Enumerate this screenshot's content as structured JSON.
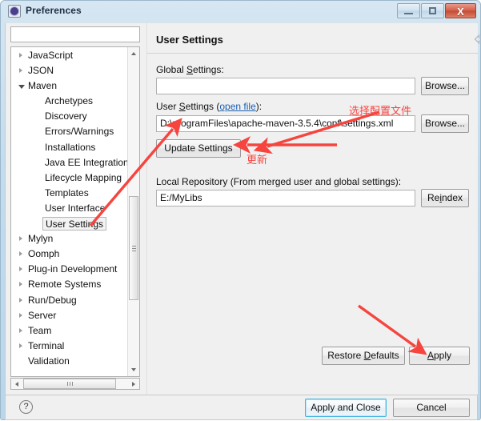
{
  "window": {
    "title": "Preferences",
    "icon": "preferences-gear-icon",
    "controls": {
      "minimize": "–",
      "maximize": "□",
      "close": "X"
    }
  },
  "sidebar": {
    "filter_value": "",
    "filter_placeholder": "",
    "items": [
      {
        "label": "JavaScript",
        "level": 1,
        "state": "collapsed",
        "selected": false
      },
      {
        "label": "JSON",
        "level": 1,
        "state": "collapsed",
        "selected": false
      },
      {
        "label": "Maven",
        "level": 1,
        "state": "expanded",
        "selected": false
      },
      {
        "label": "Archetypes",
        "level": 2,
        "state": "leaf",
        "selected": false
      },
      {
        "label": "Discovery",
        "level": 2,
        "state": "leaf",
        "selected": false
      },
      {
        "label": "Errors/Warnings",
        "level": 2,
        "state": "leaf",
        "selected": false
      },
      {
        "label": "Installations",
        "level": 2,
        "state": "leaf",
        "selected": false
      },
      {
        "label": "Java EE Integration",
        "level": 2,
        "state": "leaf",
        "selected": false
      },
      {
        "label": "Lifecycle Mapping",
        "level": 2,
        "state": "leaf",
        "selected": false
      },
      {
        "label": "Templates",
        "level": 2,
        "state": "leaf",
        "selected": false
      },
      {
        "label": "User Interface",
        "level": 2,
        "state": "leaf",
        "selected": false
      },
      {
        "label": "User Settings",
        "level": 2,
        "state": "leaf",
        "selected": true
      },
      {
        "label": "Mylyn",
        "level": 1,
        "state": "collapsed",
        "selected": false
      },
      {
        "label": "Oomph",
        "level": 1,
        "state": "collapsed",
        "selected": false
      },
      {
        "label": "Plug-in Development",
        "level": 1,
        "state": "collapsed",
        "selected": false
      },
      {
        "label": "Remote Systems",
        "level": 1,
        "state": "collapsed",
        "selected": false
      },
      {
        "label": "Run/Debug",
        "level": 1,
        "state": "collapsed",
        "selected": false
      },
      {
        "label": "Server",
        "level": 1,
        "state": "collapsed",
        "selected": false
      },
      {
        "label": "Team",
        "level": 1,
        "state": "collapsed",
        "selected": false
      },
      {
        "label": "Terminal",
        "level": 1,
        "state": "collapsed",
        "selected": false
      },
      {
        "label": "Validation",
        "level": 1,
        "state": "leaf",
        "selected": false
      }
    ]
  },
  "page": {
    "title": "User Settings",
    "nav": {
      "back": "back-arrow-icon",
      "back_menu": "chevron-down-icon",
      "forward": "forward-arrow-icon",
      "forward_menu": "chevron-down-icon",
      "overflow": "chevron-down-filled-icon"
    },
    "global_settings": {
      "label_pre": "Global ",
      "label_underlined": "S",
      "label_post": "ettings:",
      "value": "",
      "browse_label": "Browse..."
    },
    "user_settings": {
      "label_pre": "User ",
      "label_underlined": "S",
      "label_mid": "ettings (",
      "link_label": "open file",
      "label_post": "):",
      "value": "D:\\programFiles\\apache-maven-3.5.4\\conf\\settings.xml",
      "browse_label": "Browse...",
      "update_label": "Update Settings"
    },
    "local_repository": {
      "label": "Local Repository (From merged user and global settings):",
      "value": "E:/MyLibs",
      "reindex_pre": "Re",
      "reindex_underlined": "i",
      "reindex_post": "ndex"
    },
    "buttons": {
      "restore_pre": "Restore ",
      "restore_underlined": "D",
      "restore_post": "efaults",
      "apply_pre": "",
      "apply_underlined": "A",
      "apply_post": "pply"
    }
  },
  "footer": {
    "help_icon": "?",
    "apply_and_close": "Apply and Close",
    "cancel": "Cancel"
  },
  "annotations": {
    "note_select_config": "选择配置文件",
    "note_update": "更新",
    "color": "#f6453f"
  }
}
